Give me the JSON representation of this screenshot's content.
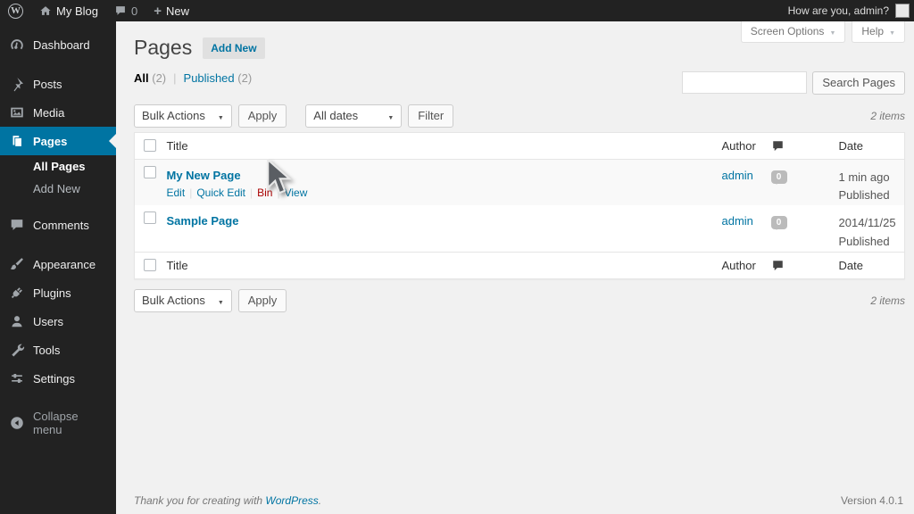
{
  "admin_bar": {
    "logo_letter": "W",
    "site_name": "My Blog",
    "comment_count": "0",
    "new_label": "New",
    "greeting": "How are you, admin?"
  },
  "sidebar": {
    "items": [
      {
        "label": "Dashboard"
      },
      {
        "label": "Posts"
      },
      {
        "label": "Media"
      },
      {
        "label": "Pages"
      },
      {
        "label": "Comments"
      },
      {
        "label": "Appearance"
      },
      {
        "label": "Plugins"
      },
      {
        "label": "Users"
      },
      {
        "label": "Tools"
      },
      {
        "label": "Settings"
      }
    ],
    "submenu": [
      {
        "label": "All Pages"
      },
      {
        "label": "Add New"
      }
    ],
    "collapse_label": "Collapse menu"
  },
  "header": {
    "title": "Pages",
    "add_new_label": "Add New",
    "screen_options_label": "Screen Options",
    "help_label": "Help"
  },
  "filters": {
    "all_label": "All",
    "all_count": "(2)",
    "published_label": "Published",
    "published_count": "(2)"
  },
  "search": {
    "value": "",
    "button_label": "Search Pages"
  },
  "tablenav": {
    "bulk_actions_label": "Bulk Actions",
    "apply_label": "Apply",
    "dates_label": "All dates",
    "filter_label": "Filter",
    "items_count": "2 items"
  },
  "table": {
    "columns": {
      "title": "Title",
      "author": "Author",
      "date": "Date"
    },
    "rows": [
      {
        "title": "My New Page",
        "actions": {
          "edit": "Edit",
          "quick_edit": "Quick Edit",
          "bin": "Bin",
          "view": "View"
        },
        "author": "admin",
        "comments": "0",
        "date_line1": "1 min ago",
        "date_line2": "Published"
      },
      {
        "title": "Sample Page",
        "author": "admin",
        "comments": "0",
        "date_line1": "2014/11/25",
        "date_line2": "Published"
      }
    ]
  },
  "footer": {
    "thanks_prefix": "Thank you for creating with",
    "wordpress_link": "WordPress",
    "suffix": ".",
    "version": "Version 4.0.1"
  },
  "colors": {
    "dark_bg": "#222",
    "accent": "#0074a2",
    "danger": "#a00",
    "page_bg": "#f1f1f1"
  }
}
